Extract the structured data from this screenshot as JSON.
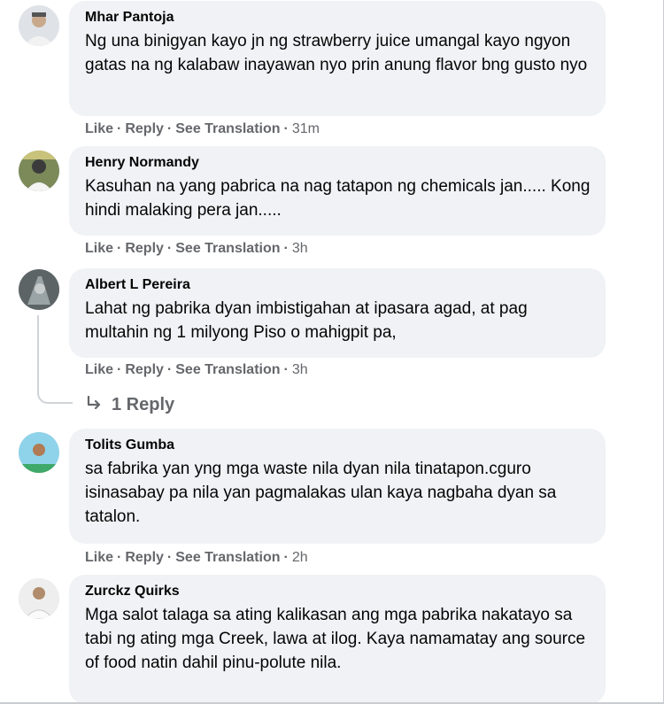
{
  "comments": [
    {
      "author": "Mhar Pantoja",
      "text": "Ng una binigyan kayo jn ng strawberry juice umangal kayo ngyon gatas na ng kalabaw inayawan nyo prin anung flavor bng gusto nyo",
      "like": "Like",
      "reply": "Reply",
      "translate": "See Translation",
      "time": "31m"
    },
    {
      "author": "Henry Normandy",
      "text": "Kasuhan na yang pabrica na nag tatapon ng chemicals jan..... Kong hindi malaking pera jan.....",
      "like": "Like",
      "reply": "Reply",
      "translate": "See Translation",
      "time": "3h"
    },
    {
      "author": "Albert L Pereira",
      "text": "Lahat ng pabrika dyan imbistigahan at ipasara agad, at pag multahin ng 1 milyong Piso o mahigpit pa,",
      "like": "Like",
      "reply": "Reply",
      "translate": "See Translation",
      "time": "3h",
      "replies_label": "1 Reply"
    },
    {
      "author": "Tolits Gumba",
      "text": "sa fabrika yan yng mga waste nila dyan nila tinatapon.cguro isinasabay pa nila yan pagmalakas ulan kaya nagbaha dyan sa tatalon.",
      "like": "Like",
      "reply": "Reply",
      "translate": "See Translation",
      "time": "2h"
    },
    {
      "author": "Zurckz Quirks",
      "text": "Mga salot talaga sa ating kalikasan ang mga pabrika nakatayo sa tabi ng ating mga Creek, lawa at ilog. Kaya namamatay ang source of food natin dahil pinu-polute nila."
    }
  ],
  "separator": "·",
  "icons": {
    "reply_arrow": "reply-arrow-icon"
  }
}
